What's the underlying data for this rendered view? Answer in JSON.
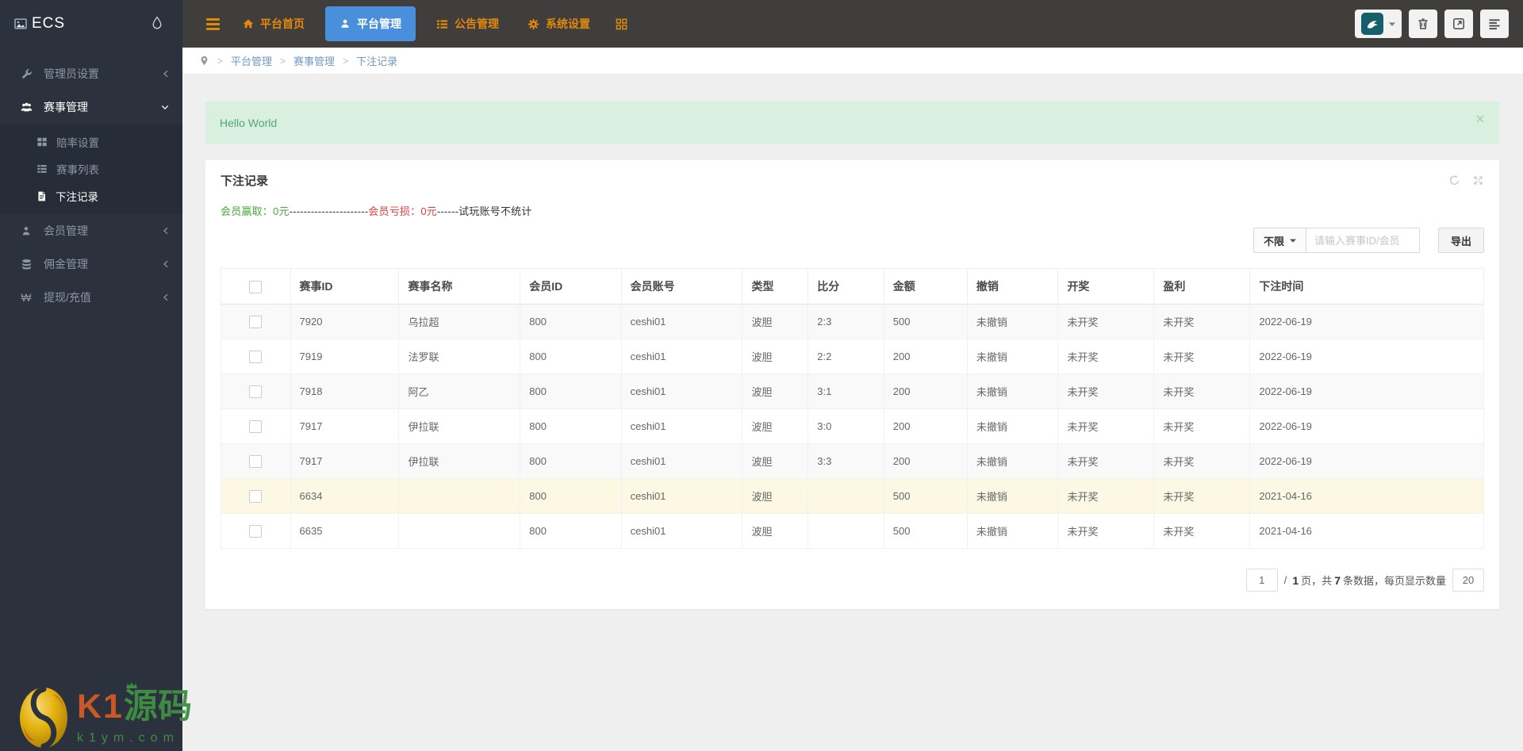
{
  "colors": {
    "navbar_bg": "#403d3d",
    "brand_bg": "#2c323d",
    "sidebar_bg": "#2c323d",
    "submenu_bg": "#272d38",
    "accent_blue": "#4a8fdb",
    "nav_orange": "#e2880c",
    "alert_bg": "#d9efdf",
    "alert_text": "#50a878",
    "breadcrumb_link": "#7298c5",
    "stripe_row": "#f9f9f9",
    "warning_row": "#fcf8e3",
    "win_green": "#46a93e",
    "loss_red": "#e03b3b",
    "skin_swatch_teal": "#135f6b"
  },
  "navbar": {
    "brand": "ECS",
    "items": [
      {
        "label": "平台首页",
        "icon": "home-icon",
        "active": false
      },
      {
        "label": "平台管理",
        "icon": "user-icon",
        "active": true
      },
      {
        "label": "公告管理",
        "icon": "announcement-icon",
        "active": false
      },
      {
        "label": "系统设置",
        "icon": "gear-icon",
        "active": false
      }
    ],
    "right_tools": [
      "skin-switcher",
      "trash",
      "external-link",
      "list"
    ]
  },
  "sidebar": {
    "items": [
      {
        "label": "管理员设置",
        "icon": "wrench-icon",
        "state": "collapsed"
      },
      {
        "label": "赛事管理",
        "icon": "users-icon",
        "state": "expanded",
        "children": [
          {
            "label": "赔率设置",
            "icon": "grid-icon",
            "active": false
          },
          {
            "label": "赛事列表",
            "icon": "table-list-icon",
            "active": false
          },
          {
            "label": "下注记录",
            "icon": "file-icon",
            "active": true
          }
        ]
      },
      {
        "label": "会员管理",
        "icon": "person-icon",
        "state": "collapsed"
      },
      {
        "label": "佣金管理",
        "icon": "database-icon",
        "state": "collapsed"
      },
      {
        "label": "提现/充值",
        "icon": "won-icon",
        "state": "collapsed"
      }
    ]
  },
  "breadcrumb": {
    "links": [
      "平台管理",
      "赛事管理",
      "下注记录"
    ],
    "separator": ">"
  },
  "alert": {
    "text": "Hello World",
    "close": "×"
  },
  "panel": {
    "title": "下注记录"
  },
  "stats": {
    "win_label": "会员赢取：",
    "win_value": "0元",
    "dashes1": "----------------------",
    "loss_label": "会员亏损：",
    "loss_value": "0元",
    "dashes2": "------",
    "note": "试玩账号不统计"
  },
  "filters": {
    "type_dropdown": "不限",
    "search_placeholder": "请输入赛事ID/会员",
    "export_label": "导出"
  },
  "table": {
    "columns": [
      "赛事ID",
      "赛事名称",
      "会员ID",
      "会员账号",
      "类型",
      "比分",
      "金额",
      "撤销",
      "开奖",
      "盈利",
      "下注时间"
    ],
    "rows": [
      {
        "cells": [
          "7920",
          "乌拉超",
          "800",
          "ceshi01",
          "波胆",
          "2:3",
          "500",
          "未撤销",
          "未开奖",
          "未开奖",
          "2022-06-19"
        ],
        "highlight": false
      },
      {
        "cells": [
          "7919",
          "法罗联",
          "800",
          "ceshi01",
          "波胆",
          "2:2",
          "200",
          "未撤销",
          "未开奖",
          "未开奖",
          "2022-06-19"
        ],
        "highlight": false
      },
      {
        "cells": [
          "7918",
          "阿乙",
          "800",
          "ceshi01",
          "波胆",
          "3:1",
          "200",
          "未撤销",
          "未开奖",
          "未开奖",
          "2022-06-19"
        ],
        "highlight": false
      },
      {
        "cells": [
          "7917",
          "伊拉联",
          "800",
          "ceshi01",
          "波胆",
          "3:0",
          "200",
          "未撤销",
          "未开奖",
          "未开奖",
          "2022-06-19"
        ],
        "highlight": false
      },
      {
        "cells": [
          "7917",
          "伊拉联",
          "800",
          "ceshi01",
          "波胆",
          "3:3",
          "200",
          "未撤销",
          "未开奖",
          "未开奖",
          "2022-06-19"
        ],
        "highlight": false
      },
      {
        "cells": [
          "6634",
          "",
          "800",
          "ceshi01",
          "波胆",
          "",
          "500",
          "未撤销",
          "未开奖",
          "未开奖",
          "2021-04-16"
        ],
        "highlight": true
      },
      {
        "cells": [
          "6635",
          "",
          "800",
          "ceshi01",
          "波胆",
          "",
          "500",
          "未撤销",
          "未开奖",
          "未开奖",
          "2021-04-16"
        ],
        "highlight": false
      }
    ]
  },
  "pagination": {
    "page_input": "1",
    "slash": "/",
    "total_pages": "1",
    "mid_text": "页，共",
    "total_records": "7",
    "tail_text": "条数据，每页显示数量",
    "per_page": "20"
  },
  "watermark": {
    "k1": "K1",
    "yuanma": "源码",
    "domain": "k1ym.com"
  }
}
